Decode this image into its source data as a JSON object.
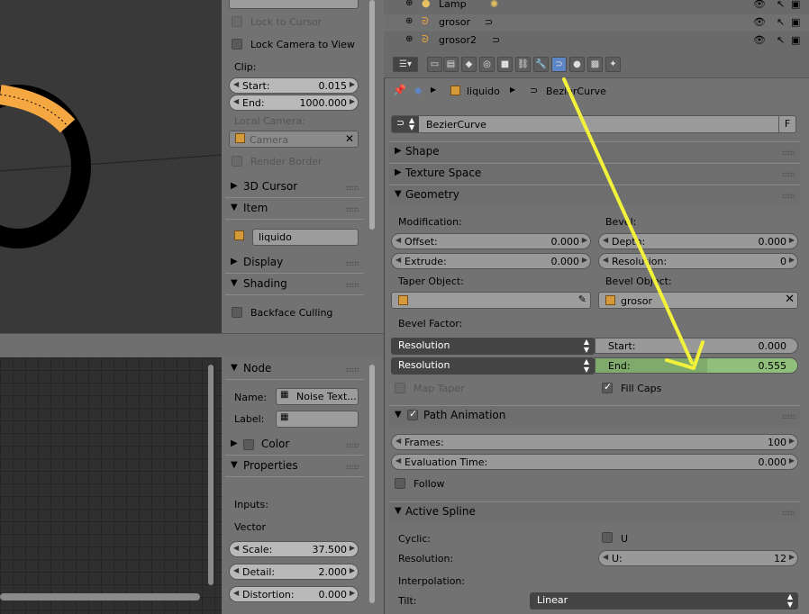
{
  "viewport_panel": {
    "lock_to_cursor": "Lock to Cursor",
    "lock_camera_to_view": "Lock Camera to View",
    "clip_label": "Clip:",
    "clip_start_label": "Start:",
    "clip_start_value": "0.015",
    "clip_end_label": "End:",
    "clip_end_value": "1000.000",
    "local_camera_label": "Local Camera:",
    "camera_field": "Camera",
    "render_border": "Render Border",
    "section_3d_cursor": "3D Cursor",
    "section_item": "Item",
    "item_name": "liquido",
    "section_display": "Display",
    "section_shading": "Shading",
    "backface_culling": "Backface Culling"
  },
  "node_panel": {
    "section_node": "Node",
    "name_label": "Name:",
    "name_value": "Noise Text...",
    "label_label": "Label:",
    "label_value": "",
    "section_color": "Color",
    "section_properties": "Properties",
    "inputs_label": "Inputs:",
    "vector_label": "Vector",
    "scale_label": "Scale:",
    "scale_value": "37.500",
    "detail_label": "Detail:",
    "detail_value": "2.000",
    "distortion_label": "Distortion:",
    "distortion_value": "0.000"
  },
  "outliner": {
    "rows": [
      {
        "name": "Lamp"
      },
      {
        "name": "grosor"
      },
      {
        "name": "grosor2"
      }
    ]
  },
  "properties": {
    "breadcrumb_object": "liquido",
    "breadcrumb_data": "BezierCurve",
    "datablock_name": "BezierCurve",
    "datablock_fake_user": "F",
    "sections": {
      "shape": "Shape",
      "texture_space": "Texture Space",
      "geometry": "Geometry",
      "path_animation": "Path Animation",
      "active_spline": "Active Spline"
    },
    "geometry": {
      "modification_label": "Modification:",
      "offset_label": "Offset:",
      "offset_value": "0.000",
      "extrude_label": "Extrude:",
      "extrude_value": "0.000",
      "bevel_label": "Bevel:",
      "depth_label": "Depth:",
      "depth_value": "0.000",
      "resolution_label": "Resolution:",
      "resolution_value": "0",
      "taper_object_label": "Taper Object:",
      "bevel_object_label": "Bevel Object:",
      "bevel_object_value": "grosor",
      "bevel_factor_label": "Bevel Factor:",
      "bevel_factor_mode_1": "Resolution",
      "bevel_factor_mode_2": "Resolution",
      "bevel_start_label": "Start:",
      "bevel_start_value": "0.000",
      "bevel_end_label": "End:",
      "bevel_end_value": "0.555",
      "bevel_end_fraction": 0.555,
      "map_taper": "Map Taper",
      "fill_caps": "Fill Caps"
    },
    "path_animation": {
      "frames_label": "Frames:",
      "frames_value": "100",
      "eval_time_label": "Evaluation Time:",
      "eval_time_value": "0.000",
      "follow": "Follow"
    },
    "active_spline": {
      "cyclic_label": "Cyclic:",
      "cyclic_u": "U",
      "resolution_label": "Resolution:",
      "u_label": "U:",
      "u_value": "12",
      "interpolation_label": "Interpolation:",
      "tilt_label": "Tilt:",
      "tilt_value": "Linear"
    }
  },
  "colors": {
    "active_tab": "#5d86c6",
    "slider_fill": "#7faa6c",
    "annotation_arrow": "#f2f23a",
    "object_orange": "#f5a742"
  }
}
